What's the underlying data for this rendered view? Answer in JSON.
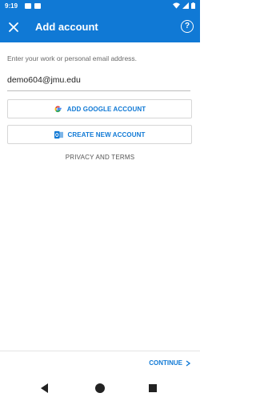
{
  "status_bar": {
    "time": "9:19"
  },
  "app_bar": {
    "title": "Add account",
    "help_label": "?"
  },
  "form": {
    "instructions": "Enter your work or personal email address.",
    "email_value": "demo604@jmu.edu",
    "add_google_label": "ADD GOOGLE ACCOUNT",
    "create_new_label": "CREATE NEW ACCOUNT",
    "privacy_label": "PRIVACY AND TERMS"
  },
  "footer": {
    "continue_label": "CONTINUE"
  },
  "colors": {
    "accent": "#1079d5"
  },
  "icons": [
    "close-icon",
    "help-icon",
    "google-icon",
    "outlook-icon",
    "chevron-right-icon",
    "back-icon",
    "home-icon",
    "recents-icon"
  ]
}
